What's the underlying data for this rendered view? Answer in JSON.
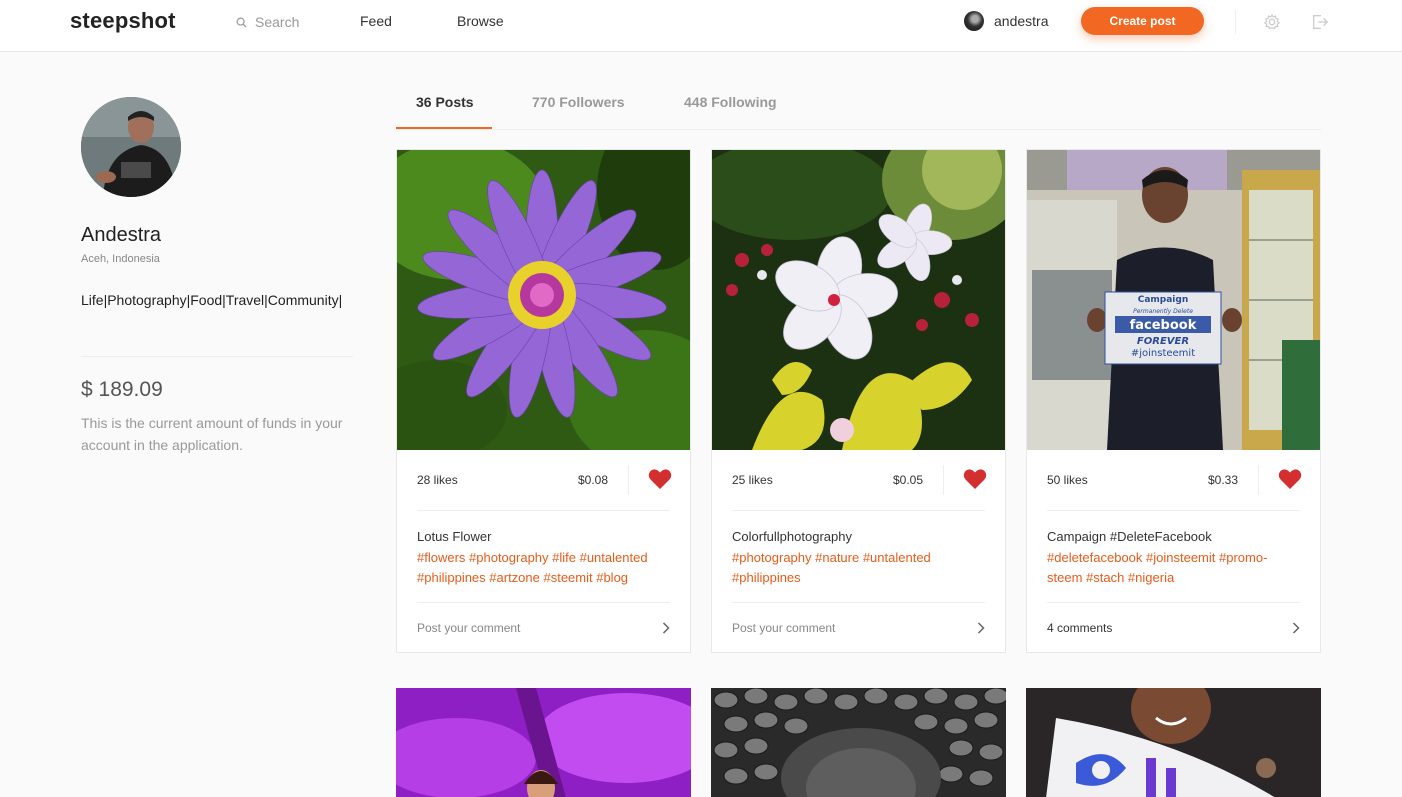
{
  "header": {
    "logo": "steepshot",
    "search_placeholder": "Search",
    "nav": [
      "Feed",
      "Browse"
    ],
    "username": "andestra",
    "create_post": "Create post"
  },
  "profile": {
    "name": "Andestra",
    "location": "Aceh, Indonesia",
    "bio": "Life|Photography|Food|Travel|Community|",
    "balance": "$ 189.09",
    "balance_desc": "This is the current amount of funds in your account in the application."
  },
  "tabs": [
    "36 Posts",
    "770 Followers",
    "448 Following"
  ],
  "posts": [
    {
      "likes": "28 likes",
      "payout": "$0.08",
      "title": "Lotus Flower",
      "tags": "#flowers #photography #life #untalented #philippines #artzone #steemit #blog",
      "comment": "Post your comment"
    },
    {
      "likes": "25 likes",
      "payout": "$0.05",
      "title": "Colorfullphotography",
      "tags": "#photography #nature #untalented #philippines",
      "comment": "Post your comment"
    },
    {
      "likes": "50 likes",
      "payout": "$0.33",
      "title": "Campaign #DeleteFacebook",
      "tags": "#deletefacebook #joinsteemit #promo-steem #stach #nigeria",
      "comment": "4 comments"
    }
  ],
  "sign": {
    "line1": "Campaign",
    "line2": "Permanently Delete",
    "line3": "facebook",
    "line4": "FOREVER",
    "line5": "#joinsteemit"
  },
  "colors": {
    "accent": "#f26722",
    "tag": "#e85c1a",
    "heart": "#d32f2f"
  }
}
